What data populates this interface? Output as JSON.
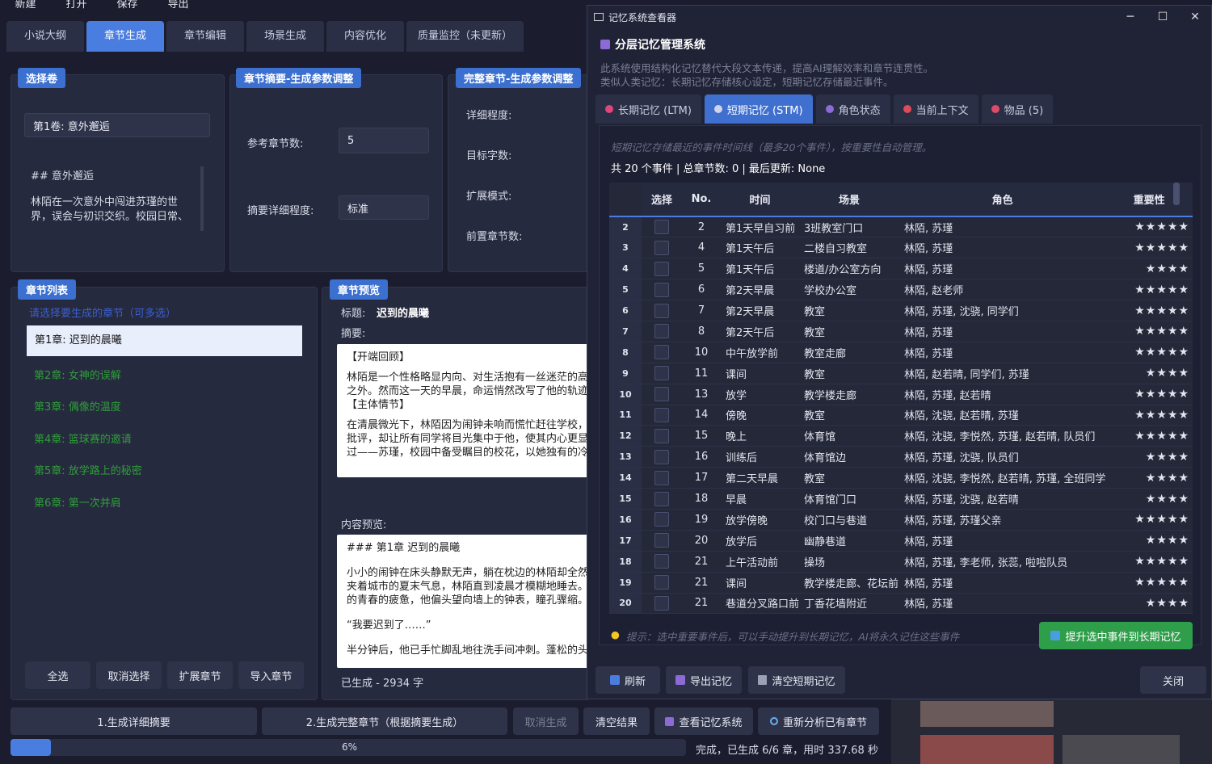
{
  "menu": [
    "新建",
    "打开",
    "保存",
    "导出"
  ],
  "tabs": [
    "小说大纲",
    "章节生成",
    "章节编辑",
    "场景生成",
    "内容优化",
    "质量监控（未更新）"
  ],
  "volume": {
    "title": "选择卷",
    "selected": "第1卷: 意外邂逅",
    "preview_heading": "## 意外邂逅",
    "preview_text": "林陌在一次意外中闯进苏瑾的世界，误会与初识交织。校园日常、"
  },
  "summary_params": {
    "title": "章节摘要-生成参数调整",
    "ref_label": "参考章节数:",
    "ref_value": "5",
    "detail_label": "摘要详细程度:",
    "detail_value": "标准"
  },
  "full_params": {
    "title": "完整章节-生成参数调整",
    "labels": [
      "详细程度:",
      "目标字数:",
      "扩展模式:",
      "前置章节数:"
    ]
  },
  "chapter_list": {
    "title": "章节列表",
    "hint": "请选择要生成的章节（可多选）",
    "items": [
      "第1章: 迟到的晨曦",
      "第2章: 女神的误解",
      "第3章: 偶像的温度",
      "第4章: 篮球赛的邀请",
      "第5章: 放学路上的秘密",
      "第6章: 第一次并肩"
    ],
    "buttons": [
      "全选",
      "取消选择",
      "扩展章节",
      "导入章节"
    ]
  },
  "preview": {
    "title": "章节预览",
    "title_label": "标题:",
    "title_value": "迟到的晨曦",
    "summary_label": "摘要:",
    "summary_lines": [
      "【开端回顾】",
      "林陌是一个性格略显内向、对生活抱有一丝迷茫的高",
      "之外。然而这一天的早晨，命运悄然改写了他的轨迹",
      "【主体情节】",
      "在清晨微光下，林陌因为闹钟未响而慌忙赶往学校，",
      "批评，却让所有同学将目光集中于他，使其内心更显",
      "过——苏瑾，校园中备受瞩目的校花，以她独有的冷"
    ],
    "content_label": "内容预览:",
    "content_lines": [
      "### 第1章 迟到的晨曦",
      "小小的闹钟在床头静默无声，躺在枕边的林陌却全然",
      "夹着城市的夏末气息，林陌直到凌晨才模糊地睡去。",
      "的青春的疲惫，他偏头望向墙上的钟表，瞳孔骤缩。",
      "“我要迟到了……”",
      "半分钟后，他已手忙脚乱地往洗手间冲刺。蓬松的头"
    ],
    "generated": "已生成 - 2934 字"
  },
  "bottom_buttons": [
    "1.生成详细摘要",
    "2.生成完整章节（根据摘要生成）",
    "取消生成",
    "清空结果",
    "查看记忆系统",
    "重新分析已有章节"
  ],
  "progress": {
    "percent": 6,
    "label": "6%",
    "status": "完成，已生成 6/6 章，用时 337.68 秒"
  },
  "memory": {
    "window_title": "记忆系统查看器",
    "heading": "分层记忆管理系统",
    "desc1": "此系统使用结构化记忆替代大段文本传递，提高AI理解效率和章节连贯性。",
    "desc2": "类似人类记忆：长期记忆存储核心设定，短期记忆存储最近事件。",
    "tabs": [
      "长期记忆 (LTM)",
      "短期记忆 (STM)",
      "角色状态",
      "当前上下文",
      "物品 (5)"
    ],
    "tab_colors": [
      "#e0457b",
      "#d0d4e8",
      "#8c6bd8",
      "#e04a5a",
      "#e04a6a"
    ],
    "stm_hint": "短期记忆存储最近的事件时间线（最多20个事件），按重要性自动管理。",
    "stats": "共 20 个事件 | 总章节数: 0 | 最后更新: None",
    "columns": [
      "选择",
      "No.",
      "时间",
      "场景",
      "角色",
      "重要性"
    ],
    "rows": [
      [
        "2",
        "2",
        "第1天早自习前",
        "3班教室门口",
        "林陌, 苏瑾",
        "5"
      ],
      [
        "3",
        "4",
        "第1天午后",
        "二楼自习教室",
        "林陌, 苏瑾",
        "5"
      ],
      [
        "4",
        "5",
        "第1天午后",
        "楼道/办公室方向",
        "林陌, 苏瑾",
        "4"
      ],
      [
        "5",
        "6",
        "第2天早晨",
        "学校办公室",
        "林陌, 赵老师",
        "5"
      ],
      [
        "6",
        "7",
        "第2天早晨",
        "教室",
        "林陌, 苏瑾, 沈骁, 同学们",
        "5"
      ],
      [
        "7",
        "8",
        "第2天午后",
        "教室",
        "林陌, 苏瑾",
        "5"
      ],
      [
        "8",
        "10",
        "中午放学前",
        "教室走廊",
        "林陌, 苏瑾",
        "5"
      ],
      [
        "9",
        "11",
        "课间",
        "教室",
        "林陌, 赵若晴, 同学们, 苏瑾",
        "4"
      ],
      [
        "10",
        "13",
        "放学",
        "教学楼走廊",
        "林陌, 苏瑾, 赵若晴",
        "5"
      ],
      [
        "11",
        "14",
        "傍晚",
        "教室",
        "林陌, 沈骁, 赵若晴, 苏瑾",
        "5"
      ],
      [
        "12",
        "15",
        "晚上",
        "体育馆",
        "林陌, 沈骁, 李悦然, 苏瑾, 赵若晴, 队员们",
        "5"
      ],
      [
        "13",
        "16",
        "训练后",
        "体育馆边",
        "林陌, 苏瑾, 沈骁, 队员们",
        "4"
      ],
      [
        "14",
        "17",
        "第二天早晨",
        "教室",
        "林陌, 沈骁, 李悦然, 赵若晴, 苏瑾, 全班同学",
        "4"
      ],
      [
        "15",
        "18",
        "早晨",
        "体育馆门口",
        "林陌, 苏瑾, 沈骁, 赵若晴",
        "4"
      ],
      [
        "16",
        "19",
        "放学傍晚",
        "校门口与巷道",
        "林陌, 苏瑾, 苏瑾父亲",
        "5"
      ],
      [
        "17",
        "20",
        "放学后",
        "幽静巷道",
        "林陌, 苏瑾",
        "4"
      ],
      [
        "18",
        "21",
        "上午活动前",
        "操场",
        "林陌, 苏瑾, 李老师, 张蕊, 啦啦队员",
        "5"
      ],
      [
        "19",
        "21",
        "课间",
        "教学楼走廊、花坛前",
        "林陌, 苏瑾",
        "5"
      ],
      [
        "20",
        "21",
        "巷道分叉路口前",
        "丁香花墙附近",
        "林陌, 苏瑾",
        "4"
      ]
    ],
    "tip": "提示：选中重要事件后，可以手动提升到长期记忆，AI将永久记住这些事件",
    "promote_button": "提升选中事件到长期记忆",
    "footer_buttons": [
      "刷新",
      "导出记忆",
      "清空短期记忆"
    ],
    "close_button": "关闭"
  },
  "colors": {
    "accent": "#3b6fd0",
    "green_button": "#2e9e4a",
    "star": "#f5a623"
  }
}
